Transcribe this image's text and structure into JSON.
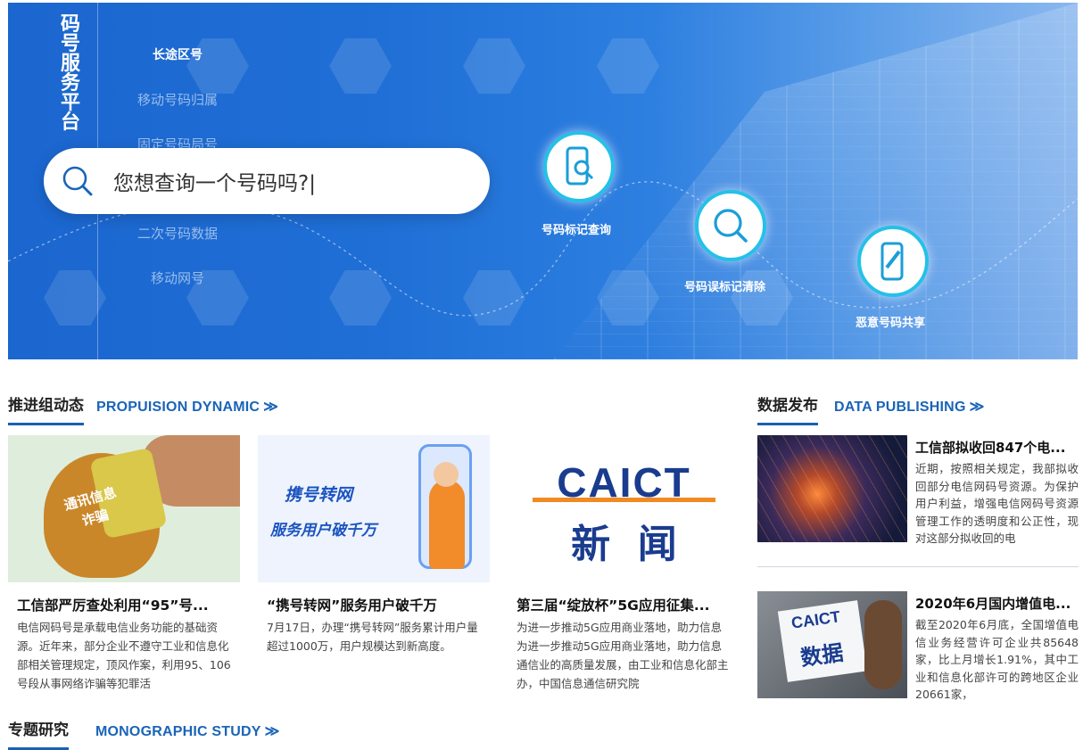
{
  "hero": {
    "vertical_title": "码号服务平台",
    "menu": [
      "长途区号",
      "移动号码归属",
      "固定号码局号",
      "二次号码数据",
      "移动网号"
    ],
    "search_placeholder": "您想查询一个号码吗?|",
    "features": [
      "号码标记查询",
      "号码误标记清除",
      "恶意号码共享"
    ],
    "accent_color": "#1f6fd6"
  },
  "dynamic": {
    "title_cn": "推进组动态",
    "title_en": "PROPUISION DYNAMIC",
    "arrow": "≫",
    "cards": [
      {
        "title": "工信部严厉查处利用“95”号...",
        "desc": "电信网码号是承载电信业务功能的基础资源。近年来，部分企业不遵守工业和信息化部相关管理规定，顶风作案，利用95、106号段从事网络诈骗等犯罪活",
        "img_text": "通讯信息诈骗"
      },
      {
        "title": "“携号转网”服务用户破千万",
        "desc": "7月17日，办理“携号转网”服务累计用户量超过1000万，用户规模达到新高度。",
        "img_text_1": "携号转网",
        "img_text_2": "服务用户破千万"
      },
      {
        "title": "第三届“绽放杯”5G应用征集...",
        "desc": "为进一步推动5G应用商业落地，助力信息为进一步推动5G应用商业落地，助力信息通信业的高质量发展，由工业和信息化部主办，中国信息通信研究院",
        "img_text_1": "CAICT",
        "img_text_2": "新  闻"
      }
    ]
  },
  "publishing": {
    "title_cn": "数据发布",
    "title_en": "DATA PUBLISHING",
    "arrow": "≫",
    "items": [
      {
        "title": "工信部拟收回847个电...",
        "desc": "近期，按照相关规定，我部拟收回部分电信网码号资源。为保护用户利益，增强电信网码号资源管理工作的透明度和公正性，现对这部分拟收回的电"
      },
      {
        "title": "2020年6月国内增值电...",
        "desc": "截至2020年6月底，全国增值电信业务经营许可企业共85648家，比上月增长1.91%，其中工业和信息化部许可的跨地区企业20661家，",
        "img_text_1": "CAICT",
        "img_text_2": "数据"
      }
    ]
  },
  "study": {
    "title_cn": "专题研究",
    "title_en": "MONOGRAPHIC STUDY",
    "arrow": "≫"
  }
}
